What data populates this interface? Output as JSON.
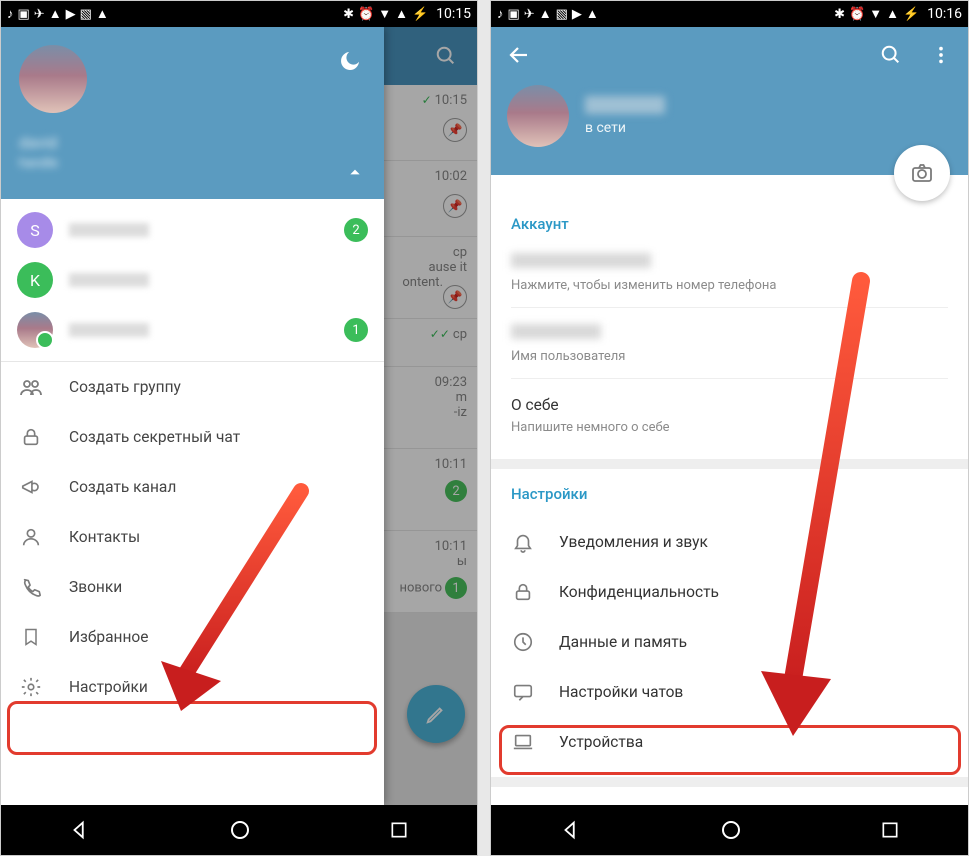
{
  "left": {
    "status_time": "10:15",
    "drawer": {
      "menu": [
        {
          "icon": "group-icon",
          "label": "Создать группу"
        },
        {
          "icon": "lock-icon",
          "label": "Создать секретный чат"
        },
        {
          "icon": "megaphone-icon",
          "label": "Создать канал"
        },
        {
          "icon": "person-icon",
          "label": "Контакты"
        },
        {
          "icon": "phone-icon",
          "label": "Звонки"
        },
        {
          "icon": "bookmark-icon",
          "label": "Избранное"
        },
        {
          "icon": "gear-icon",
          "label": "Настройки"
        }
      ],
      "accounts": [
        {
          "letter": "S",
          "badge": "2"
        },
        {
          "letter": "K",
          "badge": ""
        },
        {
          "letter": "",
          "badge": "1"
        }
      ]
    },
    "bg_chats": [
      {
        "time": "10:15",
        "mark": "check",
        "pin": true
      },
      {
        "time": "10:02",
        "mark": "",
        "pin": true
      },
      {
        "time": "ср",
        "text": "ause it\nontent.",
        "pin": true
      },
      {
        "time": "ср",
        "mark": "dcheck",
        "pin": false
      },
      {
        "time": "09:23",
        "text": "m\n-iz",
        "pin": false
      },
      {
        "time": "10:11",
        "badge": "2",
        "pin": false
      },
      {
        "time": "10:11",
        "text": "ы\nнового",
        "badge": "1",
        "pin": false
      }
    ]
  },
  "right": {
    "status_time": "10:16",
    "profile_status": "в сети",
    "sections": {
      "account": {
        "title": "Аккаунт",
        "phone_hint": "Нажмите, чтобы изменить номер телефона",
        "username_hint": "Имя пользователя",
        "about_label": "О себе",
        "about_hint": "Напишите немного о себе"
      },
      "settings": {
        "title": "Настройки",
        "items": [
          {
            "icon": "bell-icon",
            "label": "Уведомления и звук"
          },
          {
            "icon": "lock-icon",
            "label": "Конфиденциальность"
          },
          {
            "icon": "clock-icon",
            "label": "Данные и память"
          },
          {
            "icon": "chat-icon",
            "label": "Настройки чатов"
          },
          {
            "icon": "laptop-icon",
            "label": "Устройства"
          }
        ]
      }
    }
  }
}
